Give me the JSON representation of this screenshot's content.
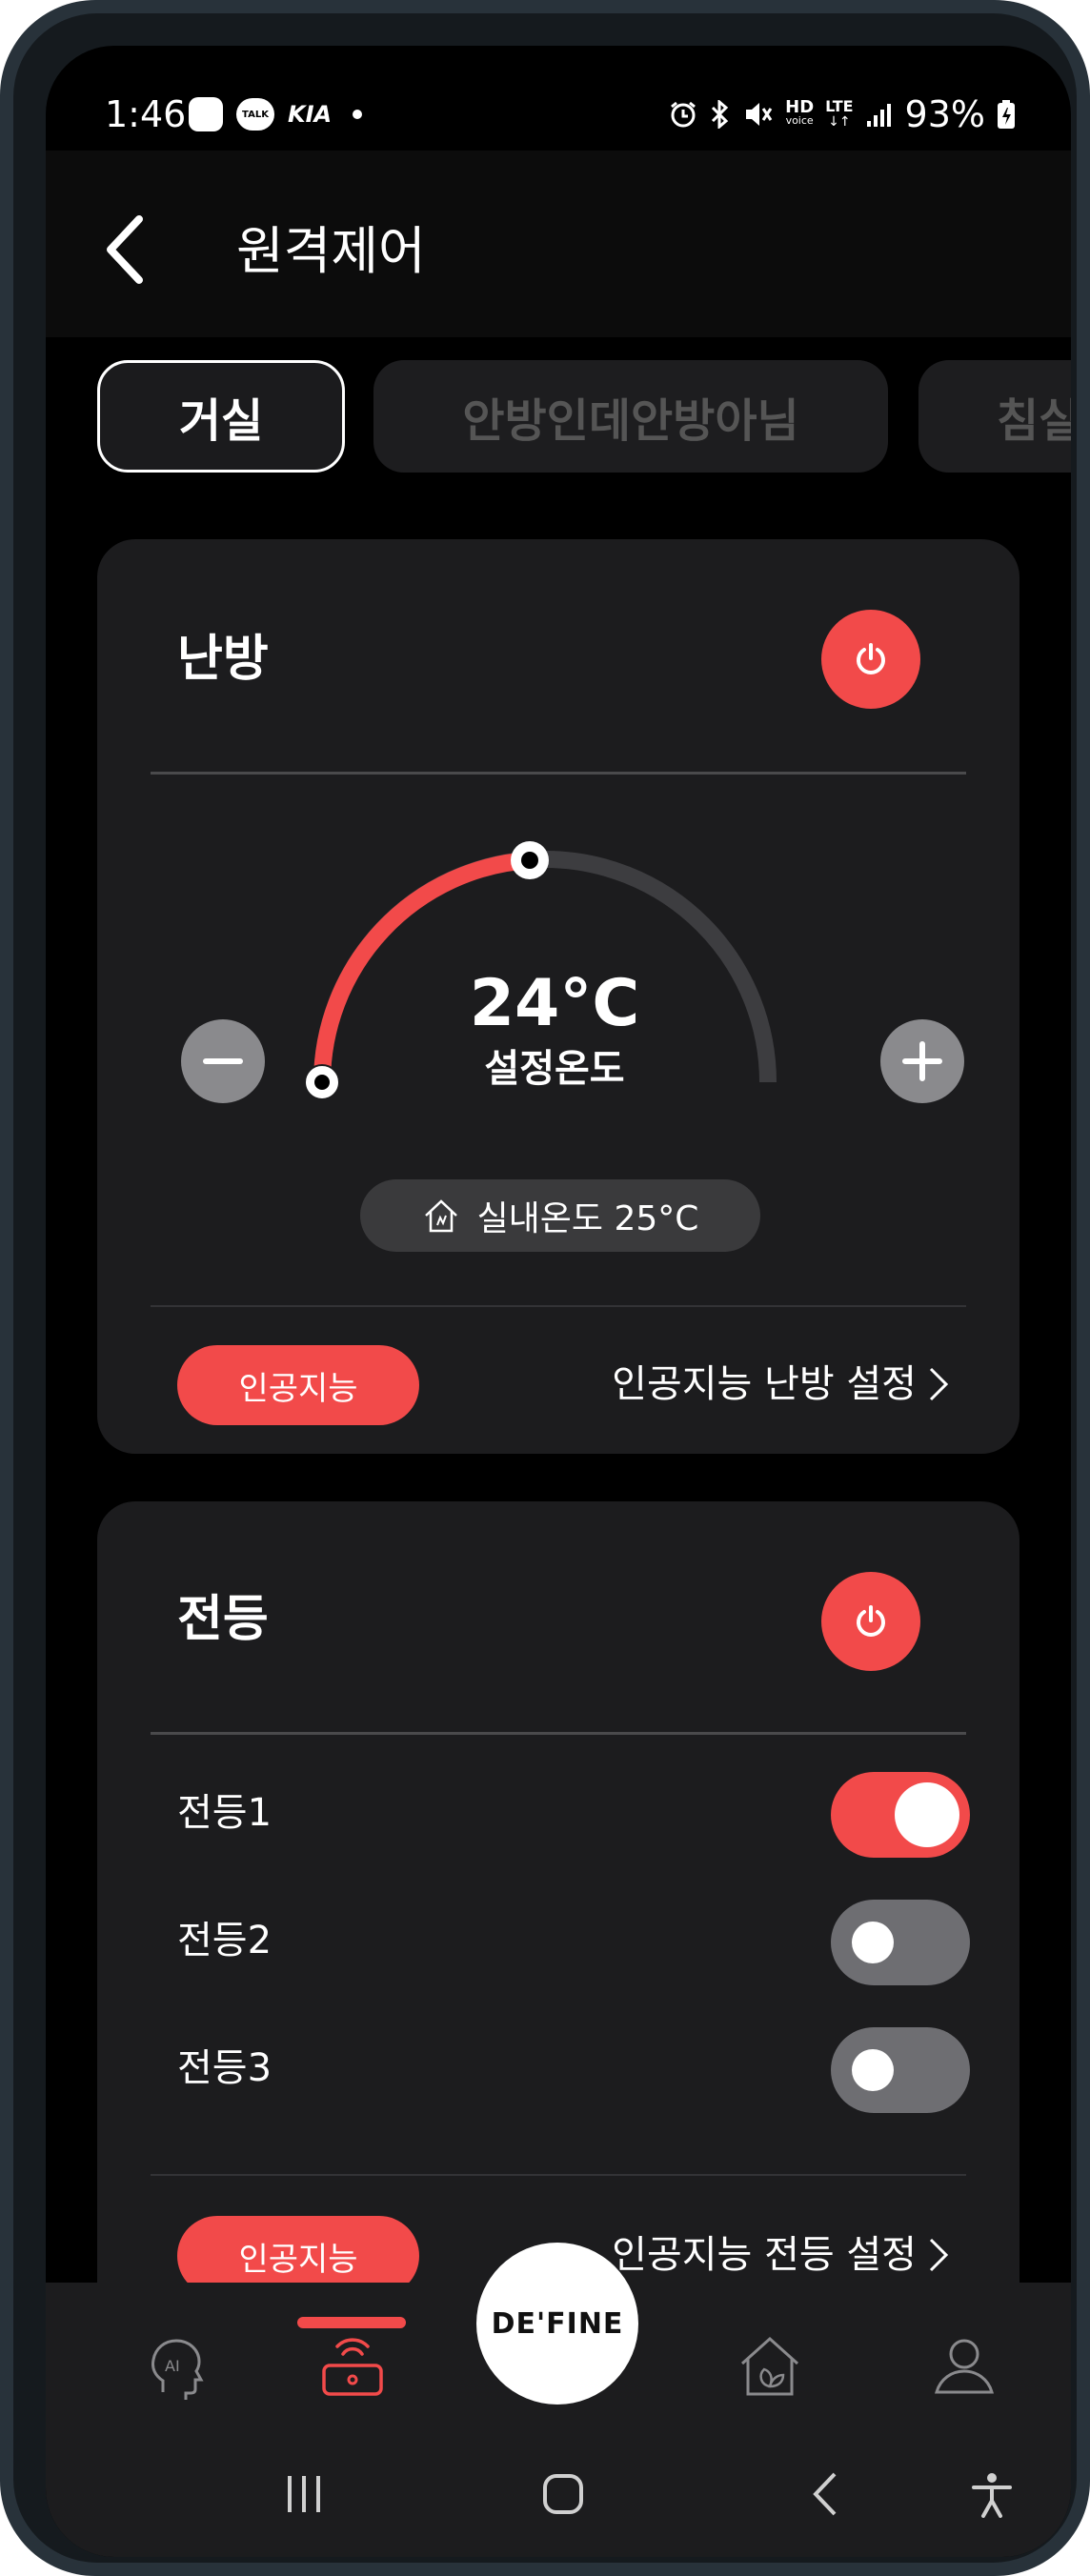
{
  "status_bar": {
    "time": "1:46",
    "talk_label": "TALK",
    "kia_label": "KIA",
    "hd_label": "HD",
    "voice_label": "voice",
    "lte_label": "LTE",
    "battery": "93%"
  },
  "header": {
    "title": "원격제어"
  },
  "rooms": {
    "tabs": [
      "거실",
      "안방인데안방아님",
      "침실"
    ],
    "active_index": 0
  },
  "heating": {
    "title": "난방",
    "power_on": true,
    "set_temperature": "24°C",
    "set_temperature_label": "설정온도",
    "indoor_temperature": "실내온도 25°C",
    "ai_badge": "인공지능",
    "ai_link": "인공지능 난방 설정"
  },
  "lighting": {
    "title": "전등",
    "power_on": true,
    "lights": [
      {
        "label": "전등1",
        "on": true
      },
      {
        "label": "전등2",
        "on": false
      },
      {
        "label": "전등3",
        "on": false
      }
    ],
    "ai_badge": "인공지능",
    "ai_link": "인공지능 전등 설정"
  },
  "bottom_nav": {
    "items": [
      "ai-head-icon",
      "remote-control-icon",
      "define-home",
      "eco-home-icon",
      "profile-icon"
    ],
    "active_index": 1,
    "center_label": "DE'FINE"
  },
  "colors": {
    "accent": "#f24a4a",
    "card": "#1c1c1e",
    "background": "#000000"
  }
}
